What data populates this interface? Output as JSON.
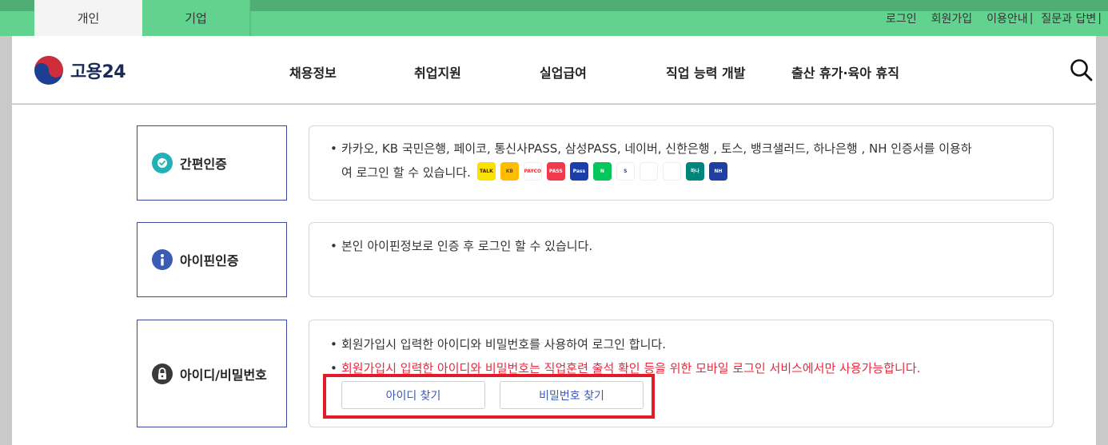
{
  "tabs": [
    {
      "label": "개인",
      "active": true
    },
    {
      "label": "기업",
      "active": false
    }
  ],
  "utility_links": [
    "로그인",
    "회원가입",
    "이용안내",
    "질문과 답변"
  ],
  "logo": {
    "text": "고용24"
  },
  "nav": [
    "채용정보",
    "취업지원",
    "실업급여",
    "직업 능력 개발",
    "출산 휴가·육아 휴직"
  ],
  "sections": [
    {
      "title": "간편인증",
      "icon": "check-shield-icon",
      "lines": [
        "카카오, KB 국민은행, 페이코, 통신사PASS, 삼성PASS, 네이버, 신한은행 , 토스, 뱅크샐러드, 하나은행 , NH 인증서를 이용하",
        "여 로그인 할 수 있습니다."
      ],
      "provider_logos": [
        {
          "name": "kakao",
          "text": "TALK",
          "bg": "#fae100",
          "fg": "#3b1e1e"
        },
        {
          "name": "kb",
          "text": "KB",
          "bg": "#ffbc00",
          "fg": "#5a4a2a"
        },
        {
          "name": "payco",
          "text": "PAYCO",
          "bg": "#ffffff",
          "fg": "#fa2828"
        },
        {
          "name": "telecom-pass",
          "text": "PASS",
          "bg": "#f2384b",
          "fg": "#ffffff"
        },
        {
          "name": "samsung-pass",
          "text": "Pass",
          "bg": "#1b3ea8",
          "fg": "#ffffff"
        },
        {
          "name": "naver",
          "text": "N",
          "bg": "#03c75a",
          "fg": "#ffffff"
        },
        {
          "name": "shinhan",
          "text": "S",
          "bg": "#ffffff",
          "fg": "#0a46b4"
        },
        {
          "name": "toss",
          "text": "",
          "bg": "#ffffff",
          "fg": "#1f74f6"
        },
        {
          "name": "banksalad",
          "text": "",
          "bg": "#ffffff",
          "fg": "#10c19a"
        },
        {
          "name": "hana",
          "text": "하나",
          "bg": "#00857a",
          "fg": "#ffffff"
        },
        {
          "name": "nh",
          "text": "NH",
          "bg": "#1f3fa2",
          "fg": "#ffffff"
        }
      ]
    },
    {
      "title": "아이핀인증",
      "icon": "info-icon",
      "lines": [
        "본인 아이핀정보로 인증 후 로그인 할 수 있습니다."
      ]
    },
    {
      "title": "아이디/비밀번호",
      "icon": "lock-icon",
      "lines": [
        "회원가입시 입력한 아이디와 비밀번호를 사용하여 로그인 합니다."
      ],
      "warning": "회원가입시 입력한 아이디와 비밀번호는 직업훈련 출석 확인 등을 위한 모바일 로그인 서비스에서만 사용가능합니다.",
      "buttons": [
        "아이디 찾기",
        "비밀번호 찾기"
      ]
    }
  ],
  "colors": {
    "topbar": "#62d38f",
    "border_accent": "#3a4a98",
    "warning": "#e8283e",
    "highlight": "#e11b2a",
    "button_text": "#3e56b6"
  }
}
